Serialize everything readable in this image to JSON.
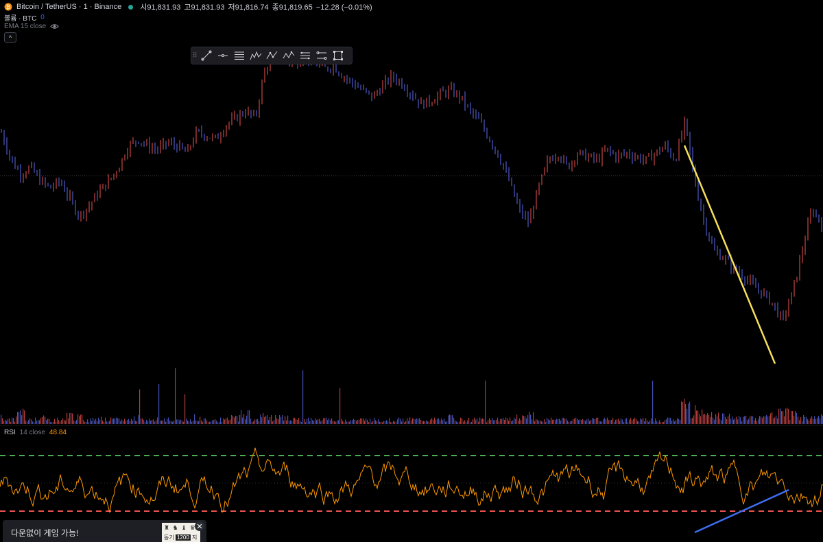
{
  "legend": {
    "symbol": "Bitcoin / TetherUS · 1 · Binance",
    "open_label": "시",
    "open": "91,831.93",
    "high_label": "고",
    "high": "91,831.93",
    "low_label": "저",
    "low": "91,816.74",
    "close_label": "종",
    "close": "91,819.65",
    "change": "−12.28 (−0.01%)",
    "volume_label": "볼륨 · BTC",
    "volume_value": "0",
    "ema_label": "EMA 15 close",
    "collapse_icon": "^",
    "rsi_label": "RSI",
    "rsi_params": "14 close",
    "rsi_value": "48.84"
  },
  "toolbar": {
    "tools": [
      "trend-line",
      "horizontal-ray",
      "fib-retracement",
      "elliott-wave",
      "abcd-pattern",
      "xabcd-pattern",
      "parallel-channel",
      "regression-trend",
      "rectangle"
    ],
    "grip": "⠿"
  },
  "ad": {
    "text": "다운없이 게임 가능!",
    "image_figures": "♜ ♞ ♝ ♛",
    "image_caption_left": "동기",
    "image_caption_num": "1200",
    "image_caption_right": "지",
    "close": "✕"
  },
  "colors": {
    "up": "#ef5350",
    "down": "#5b6cf2",
    "trendline_price": "#f7e05a",
    "trendline_rsi": "#2962ff",
    "rsi_line": "#ff9800",
    "rsi_upper": "#4caf50",
    "rsi_lower": "#ef5350"
  },
  "chart_data": {
    "type": "line",
    "title": "Bitcoin / TetherUS · 1 · Binance",
    "price_series_shape": [
      0.74,
      0.66,
      0.62,
      0.64,
      0.6,
      0.58,
      0.6,
      0.55,
      0.5,
      0.53,
      0.57,
      0.6,
      0.64,
      0.7,
      0.72,
      0.7,
      0.69,
      0.71,
      0.7,
      0.68,
      0.74,
      0.73,
      0.72,
      0.76,
      0.78,
      0.8,
      0.78,
      0.92,
      0.96,
      0.95,
      0.93,
      0.96,
      0.94,
      0.92,
      0.93,
      0.9,
      0.88,
      0.86,
      0.84,
      0.87,
      0.9,
      0.88,
      0.85,
      0.82,
      0.83,
      0.85,
      0.86,
      0.84,
      0.8,
      0.77,
      0.72,
      0.67,
      0.6,
      0.52,
      0.48,
      0.58,
      0.66,
      0.68,
      0.64,
      0.68,
      0.67,
      0.66,
      0.69,
      0.67,
      0.68,
      0.67,
      0.66,
      0.68,
      0.7,
      0.66,
      0.77,
      0.6,
      0.48,
      0.4,
      0.38,
      0.35,
      0.33,
      0.3,
      0.28,
      0.25,
      0.2,
      0.28,
      0.4,
      0.52,
      0.48
    ],
    "volume_shape": [
      0.3,
      0.2,
      0.5,
      0.2,
      0.3,
      0.2,
      0.2,
      0.4,
      0.3,
      0.2,
      0.3,
      0.2,
      0.2,
      0.2,
      0.3,
      0.2,
      0.2,
      0.2,
      0.2,
      0.2,
      0.3,
      0.2,
      0.2,
      0.2,
      0.3,
      0.5,
      0.2,
      0.4,
      0.3,
      0.3,
      0.2,
      0.2,
      0.2,
      0.2,
      0.2,
      0.2,
      0.2,
      0.2,
      0.2,
      0.2,
      0.2,
      0.2,
      0.2,
      0.2,
      0.2,
      0.2,
      0.3,
      0.2,
      0.2,
      0.2,
      0.2,
      0.2,
      0.2,
      0.3,
      0.4,
      0.2,
      0.2,
      0.2,
      0.2,
      0.2,
      0.2,
      0.2,
      0.2,
      0.2,
      0.2,
      0.2,
      0.2,
      0.2,
      0.2,
      0.2,
      0.9,
      0.6,
      0.5,
      0.4,
      0.4,
      0.3,
      0.3,
      0.3,
      0.3,
      0.4,
      0.5,
      0.4,
      0.3,
      0.3,
      0.3
    ],
    "rsi_levels": {
      "upper": 70,
      "middle": 50,
      "lower": 30
    },
    "rsi_current": 48.84,
    "series": [
      {
        "name": "RSI",
        "values": [
          48.84
        ]
      }
    ]
  }
}
